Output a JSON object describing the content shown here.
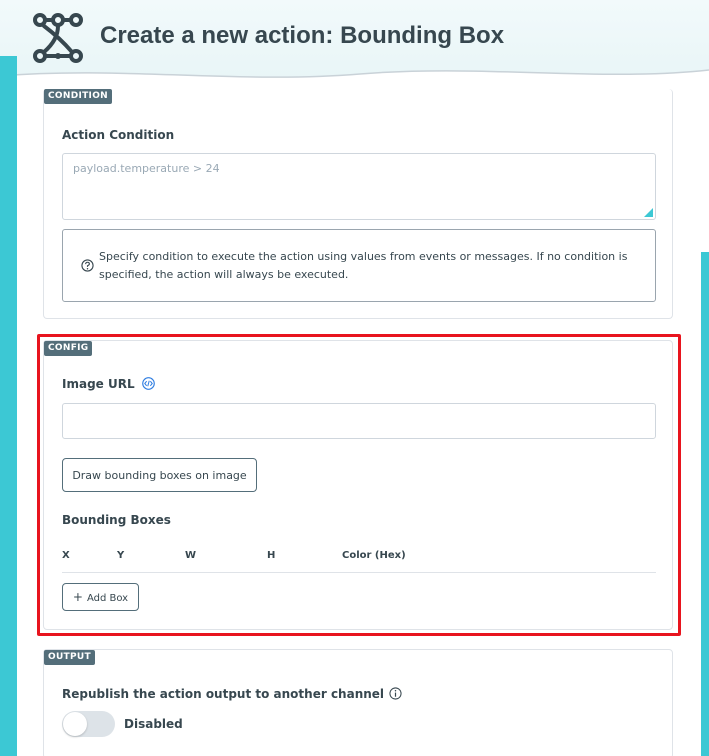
{
  "header": {
    "title": "Create a new action: Bounding Box",
    "icon": "workflow-nodes-icon"
  },
  "condition": {
    "tag": "CONDITION",
    "label": "Action Condition",
    "placeholder": "payload.temperature > 24",
    "info": "Specify condition to execute the action using values from events or messages. If no condition is specified, the action will always be executed."
  },
  "config": {
    "tag": "CONFIG",
    "image_url_label": "Image URL",
    "image_url_value": "",
    "draw_button": "Draw bounding boxes on image",
    "boxes_label": "Bounding Boxes",
    "columns": [
      "X",
      "Y",
      "W",
      "H",
      "Color (Hex)"
    ],
    "add_box": "Add Box"
  },
  "output": {
    "tag": "OUTPUT",
    "label": "Republish the action output to another channel",
    "toggle_label": "Disabled",
    "toggle_on": false
  },
  "colors": {
    "accent": "#3cc8d4",
    "highlight": "#e8141e",
    "tag_bg": "#546e7a",
    "link": "#2f7de1"
  }
}
